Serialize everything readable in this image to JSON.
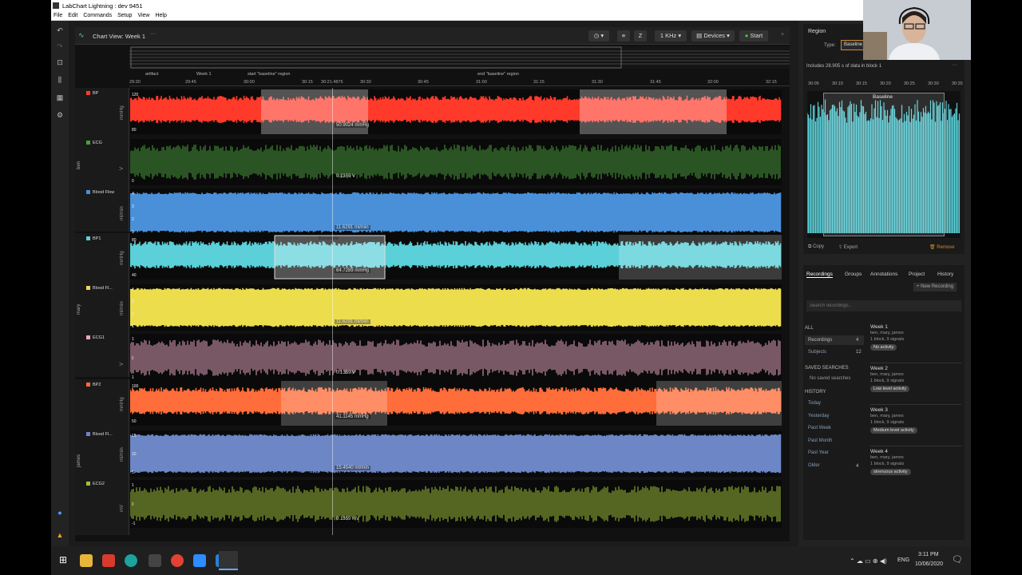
{
  "window": {
    "title": "LabChart Lightning : dev 9451"
  },
  "menu": [
    "File",
    "Edit",
    "Commands",
    "Setup",
    "View",
    "Help"
  ],
  "chart": {
    "title": "Chart View: Week 1",
    "toolbar": {
      "rate": "1 KHz",
      "devices": "Devices",
      "start": "Start"
    },
    "annotations": [
      {
        "label": "artifact"
      },
      {
        "label": "Week 1"
      },
      {
        "label": "start \"baseline\" region"
      },
      {
        "label": "end \"baseline\" region"
      }
    ],
    "time_ticks": [
      "29:30",
      "29:45",
      "30:00",
      "30:15",
      "30:21.4875",
      "30:30",
      "30:45",
      "31:00",
      "31:15",
      "31:30",
      "31:45",
      "32:00",
      "32:15"
    ],
    "subjects": [
      {
        "name": "ben",
        "channels": [
          {
            "name": "BP",
            "unit": "mmHg",
            "color": "#ff3a2a",
            "readout": "50.9024 mmHg",
            "ticks": [
              "120",
              "80"
            ]
          },
          {
            "name": "ECG",
            "unit": "V",
            "color": "#4a9e3c",
            "readout": "0.1359 V",
            "ticks": [
              "",
              "0"
            ]
          },
          {
            "name": "Blood Flow",
            "unit": "ml/min",
            "color": "#4a90d9",
            "readout": "11.6291 ml/min",
            "ticks": [
              "4",
              "3",
              "2",
              "1"
            ]
          }
        ]
      },
      {
        "name": "mary",
        "channels": [
          {
            "name": "BP1",
            "unit": "mmHg",
            "color": "#5bd0d8",
            "readout": "64.7289 mmHg",
            "ticks": [
              "80",
              "40"
            ],
            "region": "Baseline"
          },
          {
            "name": "Blood Fl...",
            "unit": "ml/min",
            "color": "#ecdd4d",
            "readout": "11.6291 ml/min",
            "ticks": [
              "4",
              "3",
              "2",
              "1"
            ]
          },
          {
            "name": "ECG1",
            "unit": "V",
            "color": "#e8a6c3",
            "readout": "0.1359 V",
            "ticks": [
              "1",
              "0",
              "1"
            ]
          }
        ]
      },
      {
        "name": "james",
        "channels": [
          {
            "name": "BP2",
            "unit": "mmHg",
            "color": "#ff6d3a",
            "readout": "41.1145 mmHg",
            "ticks": [
              "100",
              "50"
            ]
          },
          {
            "name": "Blood Fl...",
            "unit": "ml/min",
            "color": "#6c86c6",
            "readout": "15.4540 ml/min",
            "ticks": [
              "15",
              "10",
              "5"
            ]
          },
          {
            "name": "ECG2",
            "unit": "mV",
            "color": "#9dc23a",
            "readout": "0.1359 mV",
            "ticks": [
              "1",
              "0",
              "-1"
            ]
          }
        ]
      }
    ]
  },
  "region": {
    "header": "Region",
    "type_label": "Type:",
    "type_value": "Baseline",
    "info": "Includes 28.905 s of data in block 1",
    "ticks": [
      "30:05",
      "30:10",
      "30:15",
      "30:20",
      "30:25",
      "30:30",
      "30:35"
    ],
    "preview_label": "Baseline",
    "copy": "Copy",
    "export": "Export",
    "remove": "Remove"
  },
  "library": {
    "tabs": [
      "Recordings",
      "Groups",
      "Annotations",
      "Project",
      "History"
    ],
    "new_recording": "+ New Recording",
    "search_placeholder": "Search recordings...",
    "all": "ALL",
    "recordings_label": "Recordings",
    "recordings_count": "4",
    "subjects_label": "Subjects",
    "subjects_count": "12",
    "saved_searches": "SAVED SEARCHES",
    "no_saved": "No saved searches",
    "history": "HISTORY",
    "history_items": [
      "Today",
      "Yesterday",
      "Past Week",
      "Past Month",
      "Past Year",
      "Older"
    ],
    "older_count": "4",
    "recordings": [
      {
        "title": "Week 1",
        "people": "ben, mary, james",
        "meta": "1 block, 9 signals",
        "tag": "No activity"
      },
      {
        "title": "Week 2",
        "people": "ben, mary, james",
        "meta": "1 block, 9 signals",
        "tag": "Low level activity"
      },
      {
        "title": "Week 3",
        "people": "ben, mary, james",
        "meta": "1 block, 9 signals",
        "tag": "Medium level activity"
      },
      {
        "title": "Week 4",
        "people": "ben, mary, james",
        "meta": "1 block, 9 signals",
        "tag": "strenuous activity"
      }
    ]
  },
  "taskbar": {
    "lang": "ENG",
    "time": "3:11 PM",
    "date": "10/06/2020"
  }
}
